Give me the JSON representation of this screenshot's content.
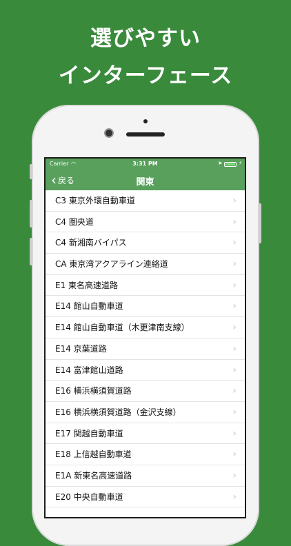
{
  "headline": {
    "line1": "選びやすい",
    "line2": "インターフェース"
  },
  "status_bar": {
    "carrier": "Carrier",
    "time": "3:31 PM"
  },
  "nav": {
    "back_label": "戻る",
    "title": "関東"
  },
  "routes": [
    "C3 東京外環自動車道",
    "C4 圏央道",
    "C4 新湘南バイパス",
    "CA 東京湾アクアライン連絡道",
    "E1 東名高速道路",
    "E14 館山自動車道",
    "E14 館山自動車道（木更津南支線）",
    "E14 京葉道路",
    "E14 富津館山道路",
    "E16 横浜横須賀道路",
    "E16 横浜横須賀道路（金沢支線）",
    "E17 関越自動車道",
    "E18 上信越自動車道",
    "E1A 新東名高速道路",
    "E20 中央自動車道"
  ],
  "colors": {
    "background": "#3a8a3c",
    "navbar": "#58a05c"
  }
}
